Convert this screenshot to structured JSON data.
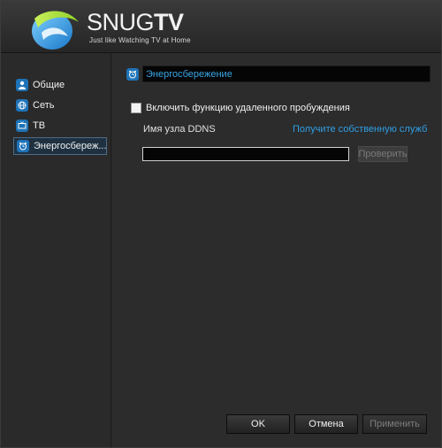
{
  "header": {
    "brand_part1": "SNUG",
    "brand_part2": "TV",
    "tagline": "Just like Watching TV at Home",
    "logo_icon": "snugtv-swirl-logo"
  },
  "sidebar": {
    "items": [
      {
        "label": "Общие",
        "icon": "user-icon",
        "active": false
      },
      {
        "label": "Сеть",
        "icon": "globe-icon",
        "active": false
      },
      {
        "label": "ТВ",
        "icon": "tv-icon",
        "active": false
      },
      {
        "label": "Энергосбереж...",
        "icon": "alarm-clock-icon",
        "active": true
      }
    ]
  },
  "main": {
    "section_title": "Энергосбережение",
    "section_icon": "alarm-clock-icon",
    "wake_label": "Включить функцию удаленного пробуждения",
    "wake_checked": false,
    "ddns_label": "Имя узла DDNS",
    "service_link": "Получите собственную служб",
    "ddns_value": "",
    "check_button": "Проверить"
  },
  "footer": {
    "ok": "OK",
    "cancel": "Отмена",
    "apply": "Применить"
  },
  "colors": {
    "accent": "#1e73b8",
    "link": "#2f9fe6",
    "title_text": "#39a6e6"
  }
}
